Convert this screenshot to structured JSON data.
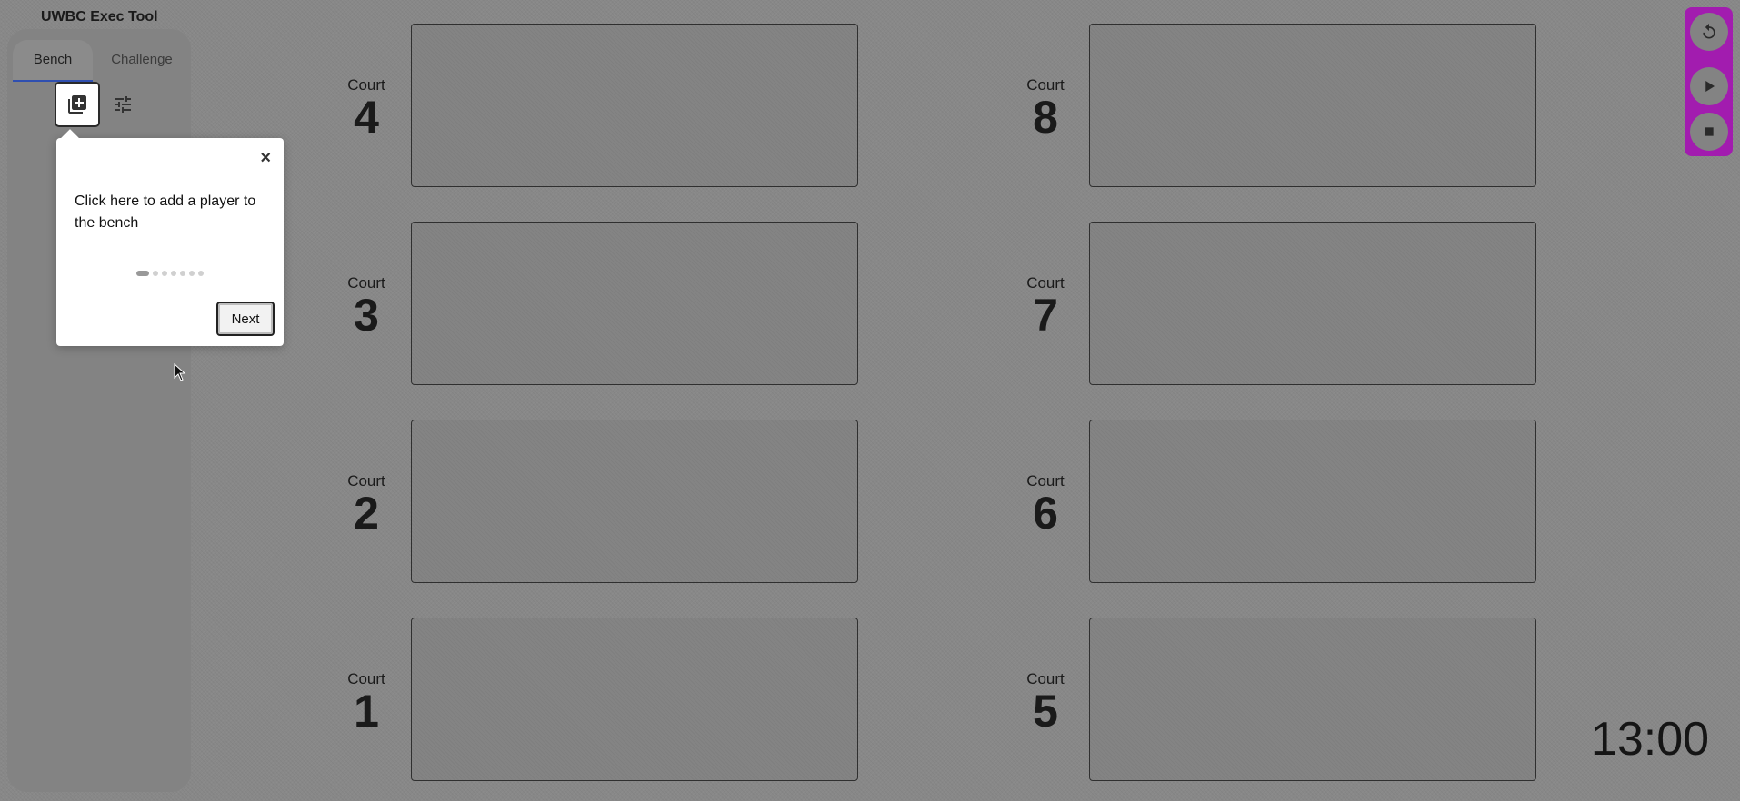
{
  "app": {
    "title": "UWBC Exec Tool"
  },
  "sidebar": {
    "tabs": [
      {
        "label": "Bench",
        "active": true
      },
      {
        "label": "Challenge",
        "active": false
      }
    ],
    "toolbar": {
      "add_player_icon": "add-to-queue-icon",
      "settings_icon": "sliders-icon"
    }
  },
  "tour_popover": {
    "message": "Click here to add a player to the bench",
    "close_glyph": "×",
    "next_label": "Next",
    "current_step": 1,
    "total_steps": 7
  },
  "courts": [
    {
      "word": "Court",
      "number": "4"
    },
    {
      "word": "Court",
      "number": "3"
    },
    {
      "word": "Court",
      "number": "2"
    },
    {
      "word": "Court",
      "number": "1"
    },
    {
      "word": "Court",
      "number": "8"
    },
    {
      "word": "Court",
      "number": "7"
    },
    {
      "word": "Court",
      "number": "6"
    },
    {
      "word": "Court",
      "number": "5"
    }
  ],
  "timer": {
    "display": "13:00",
    "controls": [
      {
        "icon": "reset-icon"
      },
      {
        "icon": "play-icon"
      },
      {
        "icon": "stop-icon"
      }
    ],
    "accent_color": "#a21caf"
  }
}
